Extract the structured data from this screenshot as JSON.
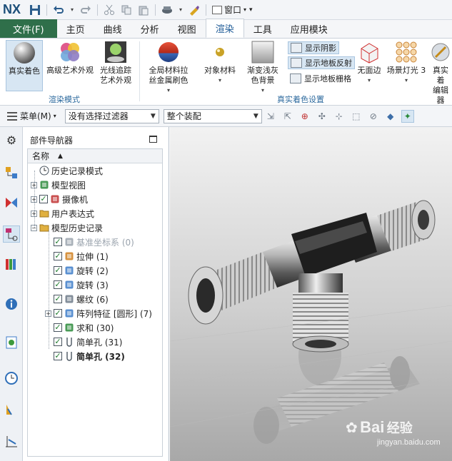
{
  "app": {
    "logo": "NX",
    "window_menu_label": "窗口"
  },
  "quick_access": {
    "icons": [
      "save-icon",
      "undo-icon",
      "redo-icon",
      "cut-icon",
      "copy-icon",
      "paste-icon",
      "touch-mode-icon",
      "repeat-command-icon",
      "window-icon"
    ]
  },
  "tabs": [
    {
      "label": "文件(F)",
      "kind": "file"
    },
    {
      "label": "主页"
    },
    {
      "label": "曲线"
    },
    {
      "label": "分析"
    },
    {
      "label": "视图"
    },
    {
      "label": "渲染",
      "active": true
    },
    {
      "label": "工具"
    },
    {
      "label": "应用模块"
    }
  ],
  "ribbon": {
    "render_mode_group": {
      "label": "渲染模式",
      "buttons": [
        {
          "label": "真实着色",
          "selected": true
        },
        {
          "label": "高级艺术外观"
        },
        {
          "label": "光线追踪",
          "label2": "艺术外观"
        }
      ]
    },
    "shading_group": {
      "label": "真实着色设置",
      "buttons": [
        {
          "label": "全局材料拉",
          "label2": "丝金属刷色"
        },
        {
          "label": "对象材料"
        },
        {
          "label": "渐变浅灰",
          "label2": "色背景"
        }
      ],
      "toggles": [
        {
          "label": "显示阴影",
          "on": true
        },
        {
          "label": "显示地板反射",
          "on": false
        },
        {
          "label": "显示地板栅格",
          "on": false
        }
      ],
      "right_buttons": [
        {
          "label": "无面边"
        },
        {
          "label": "场景灯光 3"
        },
        {
          "label": "真实着",
          "label2": "编辑器"
        }
      ]
    }
  },
  "selection_bar": {
    "menu_label": "菜单(M)",
    "filter_value": "没有选择过滤器",
    "scope_value": "整个装配"
  },
  "navigator": {
    "title": "部件导航器",
    "column_header": "名称",
    "nodes": [
      {
        "label": "历史记录模式",
        "level": 0,
        "expander": "",
        "checked": null,
        "icon": "clock-icon"
      },
      {
        "label": "模型视图",
        "level": 0,
        "expander": "+",
        "checked": null,
        "icon": "model-view-icon"
      },
      {
        "label": "摄像机",
        "level": 0,
        "expander": "+",
        "checked": true,
        "icon": "camera-icon"
      },
      {
        "label": "用户表达式",
        "level": 0,
        "expander": "+",
        "checked": null,
        "icon": "folder-icon"
      },
      {
        "label": "模型历史记录",
        "level": 0,
        "expander": "-",
        "checked": null,
        "icon": "folder-icon"
      },
      {
        "label": "基准坐标系 (0)",
        "level": 1,
        "expander": "",
        "checked": true,
        "icon": "datum-csys-icon",
        "greyed": true
      },
      {
        "label": "拉伸 (1)",
        "level": 1,
        "expander": "",
        "checked": true,
        "icon": "extrude-icon"
      },
      {
        "label": "旋转 (2)",
        "level": 1,
        "expander": "",
        "checked": true,
        "icon": "revolve-icon"
      },
      {
        "label": "旋转 (3)",
        "level": 1,
        "expander": "",
        "checked": true,
        "icon": "revolve-icon"
      },
      {
        "label": "螺纹 (6)",
        "level": 1,
        "expander": "",
        "checked": true,
        "icon": "thread-icon"
      },
      {
        "label": "阵列特征 [圆形] (7)",
        "level": 1,
        "expander": "+",
        "checked": true,
        "icon": "pattern-icon"
      },
      {
        "label": "求和 (30)",
        "level": 1,
        "expander": "",
        "checked": true,
        "icon": "unite-icon"
      },
      {
        "label": "简单孔 (31)",
        "level": 1,
        "expander": "",
        "checked": true,
        "icon": "hole-icon"
      },
      {
        "label": "简单孔 (32)",
        "level": 1,
        "expander": "",
        "checked": true,
        "icon": "hole-icon",
        "bold": true
      }
    ]
  },
  "resource_bar": {
    "icons": [
      "settings-gear-icon",
      "assembly-navigator-icon",
      "constraint-navigator-icon",
      "part-navigator-icon",
      "reuse-library-icon",
      "hd3d-tools-icon",
      "web-browser-icon",
      "history-icon",
      "system-materials-icon",
      "system-scene-icon"
    ]
  },
  "watermark": {
    "brand": "Bai",
    "brand_suffix": "经验",
    "url": "jingyan.baidu.com"
  },
  "colors": {
    "file_tab": "#2f6f4a",
    "active_tab_text": "#1d5a96",
    "group_label": "#2d6a9e",
    "selected_button_bg": "#d7e6f3"
  }
}
